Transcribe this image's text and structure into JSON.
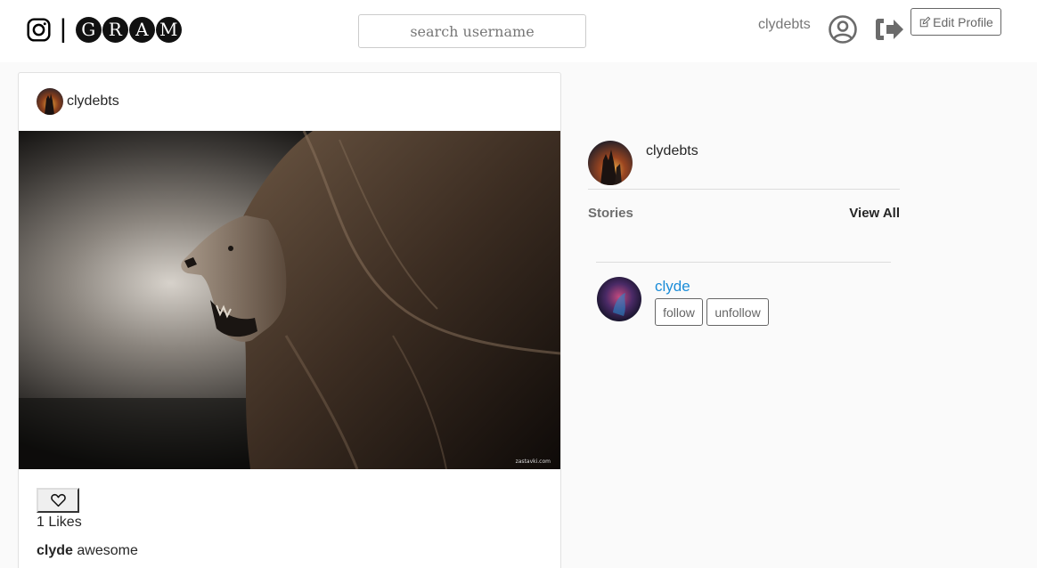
{
  "navbar": {
    "brand_separator": "|",
    "brand_letters": [
      "G",
      "R",
      "A",
      "M"
    ],
    "search_placeholder": "search username",
    "username": "clydebts",
    "edit_profile_label": "Edit Profile",
    "icons": {
      "brand": "instagram-icon",
      "profile": "user-circle-icon",
      "logout": "sign-out-icon",
      "edit": "edit-icon"
    }
  },
  "post": {
    "author": "clydebts",
    "image_watermark": "zastavki.com",
    "like_icon": "heart-outline-icon",
    "likes_count": "1 Likes",
    "caption_user": "clyde",
    "caption_text": "awesome"
  },
  "sidebar": {
    "username": "clydebts",
    "stories_label": "Stories",
    "view_all_label": "View All",
    "suggested": [
      {
        "username": "clyde",
        "follow_label": "follow",
        "unfollow_label": "unfollow"
      }
    ]
  },
  "colors": {
    "link": "#1a8cd8",
    "muted_text": "#777777",
    "page_bg": "#fafafa",
    "border": "#e1e1e1"
  }
}
